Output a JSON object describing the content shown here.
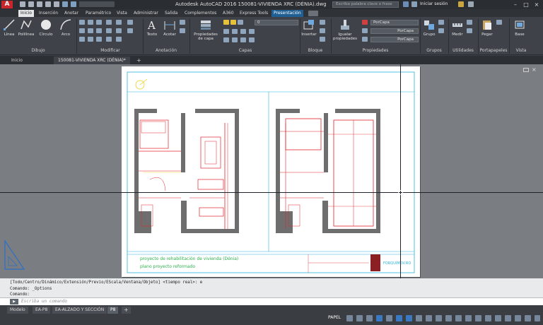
{
  "app": {
    "logo_letter": "A",
    "window_title": "Autodesk AutoCAD 2016   150081-VIVIENDA XRC (DÉNIA).dwg",
    "search_placeholder": "Escriba palabra clave o frase",
    "signin_label": "Iniciar sesión",
    "workspace_combo": ""
  },
  "ribbon_tabs": [
    "Inicio",
    "Inserción",
    "Anotar",
    "Paramétrico",
    "Vista",
    "Administrar",
    "Salida",
    "Complementos",
    "A360",
    "Express Tools",
    "Presentación"
  ],
  "ribbon": {
    "panels": [
      "Dibujo",
      "Modificar",
      "Anotación",
      "Capas",
      "Bloque",
      "Propiedades",
      "Grupos",
      "Utilidades",
      "Portapapeles",
      "Vista"
    ],
    "buttons": {
      "linea": "Línea",
      "polilinea": "Polilínea",
      "circulo": "Círculo",
      "arco": "Arco",
      "texto": "Texto",
      "acotar": "Acotar",
      "propiedades_capa": "Propiedades de capa",
      "insertar": "Insertar",
      "igualar": "Igualar propiedades",
      "grupo": "Grupo",
      "medir": "Medir",
      "pegar": "Pegar",
      "base": "Base"
    },
    "layer_combo": "0",
    "color_combo": "PorCapa",
    "linetype_combo": "PorCapa",
    "lineweight_combo": "PorCapa"
  },
  "doc_tabs": [
    "Inicio",
    "150081-VIVIENDA XRC (DÉNIA)*"
  ],
  "drawing": {
    "title_line1": "proyecto de rehabilitación de vivienda (Dénia)",
    "title_line2": "plano   proyecto reformado",
    "logo_text": "FORQUIMOV.RO"
  },
  "command": {
    "history": [
      "[Todo/Centro/Dinámico/Extensión/Previo/EScala/Ventana/Objeto] <tiempo real>: e",
      "Comando: _Options",
      "Comando:"
    ],
    "placeholder": "Escriba un comando",
    "prompt_icon": "x-prompt-icon"
  },
  "layout_tabs": [
    "Modelo",
    "EA-P8",
    "EA-ALZADO Y SECCIÓN",
    "P8"
  ],
  "status": {
    "space": "PAPEL"
  },
  "colors": {
    "accent_tab": "#1f5f94",
    "appbtn": "#c8262b",
    "linework_red": "#e0242b"
  }
}
